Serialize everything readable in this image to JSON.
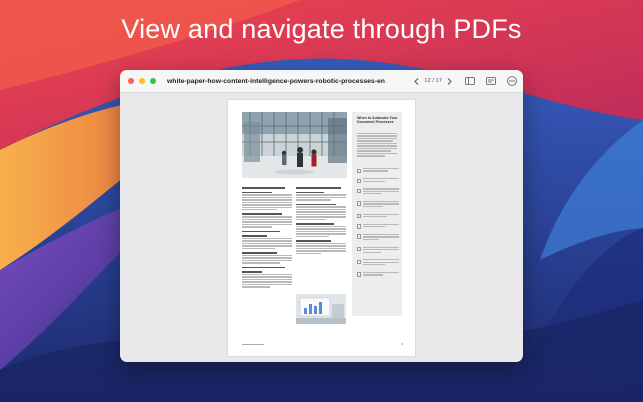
{
  "headline": "View and navigate through PDFs",
  "window": {
    "document_title": "white-paper-how-content-intelligence-powers-robotic-processes-en",
    "page_indicator": "12 / 17",
    "toolbar_icons": [
      "chevron-left-icon",
      "chevron-right-icon",
      "sidebar-icon",
      "form-icon",
      "more-icon"
    ]
  },
  "colors": {
    "background_blue": "#2a3f8f",
    "background_red": "#e0384b",
    "background_orange": "#f19a3e",
    "accent_purple": "#8a4bb0",
    "light_red": "#fe5f57",
    "light_yellow": "#febc2e",
    "light_green": "#28c840"
  },
  "page": {
    "sidebar_title": "When to Automate Your Document Processes",
    "page_number": "9"
  }
}
